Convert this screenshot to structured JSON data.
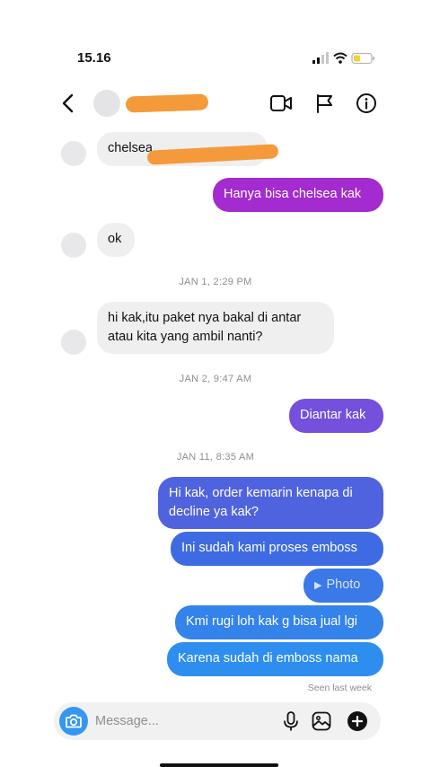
{
  "status_bar": {
    "time": "15.16"
  },
  "header": {
    "back_icon": "chevron-left-icon",
    "video_icon": "video-camera-icon",
    "flag_icon": "flag-icon",
    "info_icon": "info-icon"
  },
  "thread": {
    "messages": [
      {
        "text": "chelsea"
      },
      {
        "text": "Hanya bisa chelsea kak"
      },
      {
        "text": "ok"
      },
      {
        "text_line1": "hi kak,itu paket nya bakal di antar",
        "text_line2": "atau kita yang ambil nanti?"
      },
      {
        "text": "Diantar kak"
      },
      {
        "text_line1": "Hi kak, order kemarin kenapa di",
        "text_line2": "decline ya kak?"
      },
      {
        "text": "Ini sudah kami proses emboss"
      },
      {
        "text": "Photo"
      },
      {
        "text": "Kmi rugi loh kak g bisa jual lgi"
      },
      {
        "text": "Karena sudah di emboss nama"
      }
    ],
    "timestamps": [
      "JAN 1, 2:29 PM",
      "JAN 2, 9:47 AM",
      "JAN 11, 8:35 AM"
    ],
    "seen_status": "Seen last week"
  },
  "composer": {
    "placeholder": "Message..."
  },
  "colors": {
    "incoming_bubble": "#efefef",
    "outgoing_purple": "#a32bcf",
    "outgoing_violet": "#7450dc",
    "outgoing_blue": "#3f6be2",
    "outgoing_lightblue": "#2d8ef0",
    "accent": "#3797f0",
    "redaction": "#f59a3b"
  }
}
